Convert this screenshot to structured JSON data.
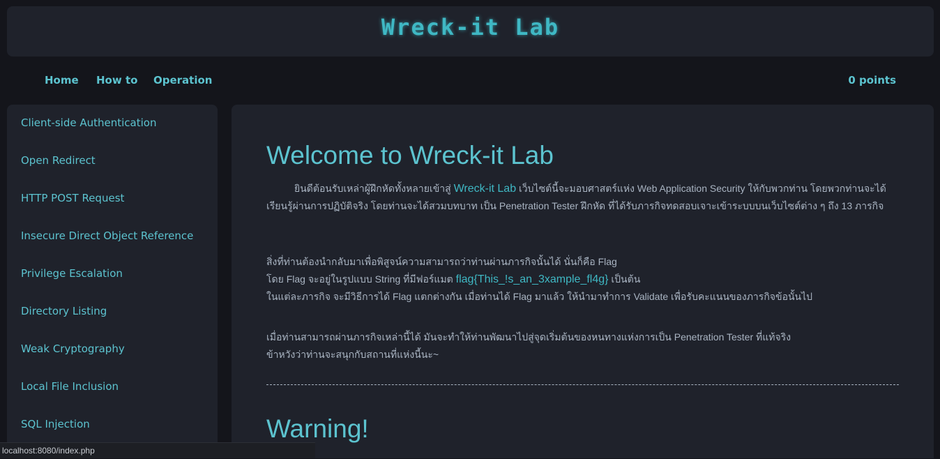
{
  "header": {
    "title": "Wreck-it Lab"
  },
  "nav": {
    "home": "Home",
    "howto": "How to",
    "operation": "Operation",
    "points": "0 points"
  },
  "sidebar": {
    "items": [
      "Client-side Authentication",
      "Open Redirect",
      "HTTP POST Request",
      "Insecure Direct Object Reference",
      "Privilege Escalation",
      "Directory Listing",
      "Weak Cryptography",
      "Local File Inclusion",
      "SQL Injection"
    ]
  },
  "main": {
    "welcome_title": "Welcome to Wreck-it Lab",
    "p1_a": "ยินดีต้อนรับเหล่าผู้ฝึกหัดทั้งหลายเข้าสู่ ",
    "p1_highlight": "Wreck-it Lab",
    "p1_b": " เว็บไซต์นี้จะมอบศาสตร์แห่ง Web Application Security ให้กับพวกท่าน โดยพวกท่านจะได้เรียนรู้ผ่านการปฏิบัติจริง โดยท่านจะได้สวมบทบาท เป็น Penetration Tester ฝึกหัด ที่ได้รับภารกิจทดสอบเจาะเข้าระบบบนเว็บไซต์ต่าง ๆ ถึง 13 ภารกิจ",
    "p2_line1": "สิ่งที่ท่านต้องนำกลับมาเพื่อพิสูจน์ความสามารถว่าท่านผ่านภารกิจนั้นได้ นั่นก็คือ Flag",
    "p2_line2_a": "โดย Flag จะอยู่ในรูปแบบ String ที่มีฟอร์แมต ",
    "p2_line2_flag": "flag{This_!s_an_3xample_fl4g}",
    "p2_line2_b": " เป็นต้น",
    "p2_line3": "ในแต่ละภารกิจ จะมีวิธีการได้ Flag แตกต่างกัน เมื่อท่านได้ Flag มาแล้ว ให้นำมาทำการ Validate เพื่อรับคะแนนของภารกิจข้อนั้นไป",
    "p3_line1": "เมื่อท่านสามารถผ่านภารกิจเหล่านี้ได้ มันจะทำให้ท่านพัฒนาไปสู่จุดเริ่มต้นของหนทางแห่งการเป็น Penetration Tester ที่แท้จริง",
    "p3_line2": "ข้าหวังว่าท่านจะสนุกกับสถานที่แห่งนี้นะ~",
    "warning_title": "Warning!"
  },
  "statusbar": {
    "url": "localhost:8080/index.php"
  }
}
